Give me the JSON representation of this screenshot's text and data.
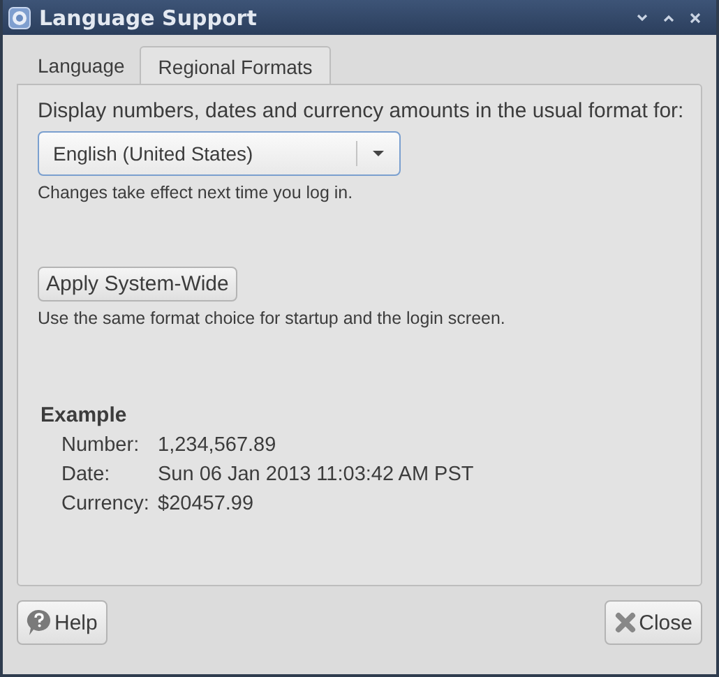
{
  "window": {
    "title": "Language Support"
  },
  "tabs": [
    {
      "label": "Language",
      "selected": false
    },
    {
      "label": "Regional Formats",
      "selected": true
    }
  ],
  "format_prompt": "Display numbers, dates and currency amounts in the usual format for:",
  "format_select": {
    "value": "English (United States)"
  },
  "format_note": "Changes take effect next time you log in.",
  "apply_button": "Apply System-Wide",
  "apply_note": "Use the same format choice for startup and the login screen.",
  "example": {
    "heading": "Example",
    "rows": [
      {
        "label": "Number:",
        "value": "1,234,567.89"
      },
      {
        "label": "Date:",
        "value": "Sun 06 Jan 2013 11:03:42 AM PST"
      },
      {
        "label": "Currency:",
        "value": "$20457.99"
      }
    ]
  },
  "buttons": [
    {
      "kind": "help",
      "label": "Help"
    },
    {
      "kind": "close",
      "label": "Close"
    }
  ]
}
